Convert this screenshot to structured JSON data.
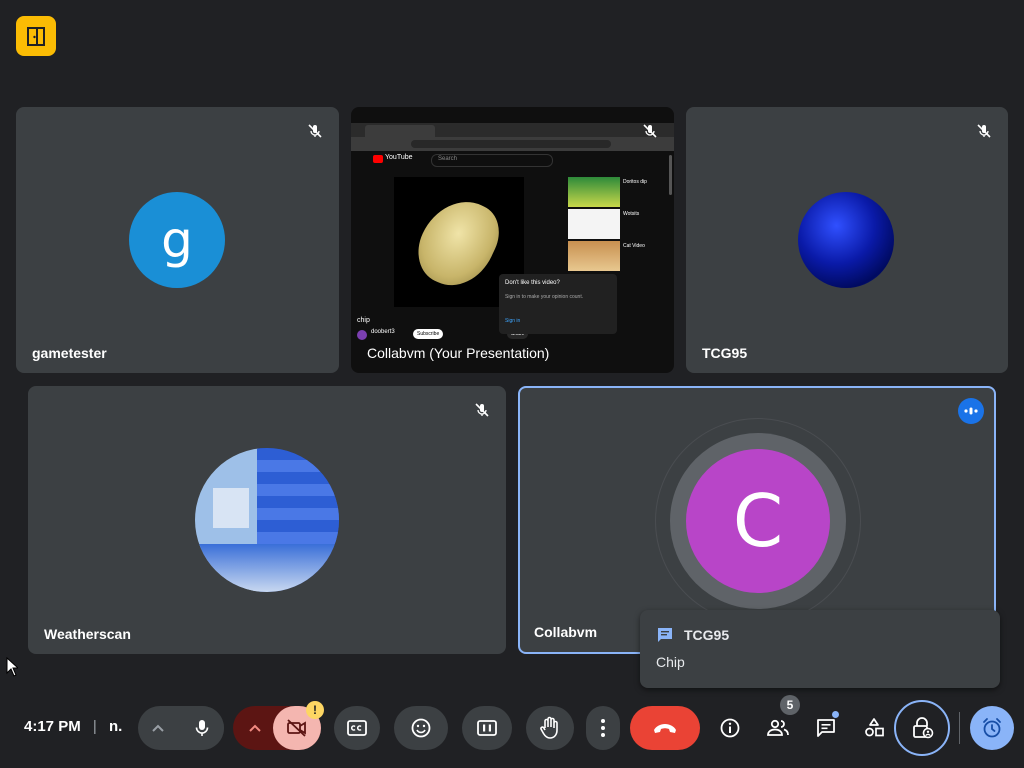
{
  "participants": {
    "tile1": {
      "name": "gametester",
      "initial": "g",
      "avatar_color": "#1a8fd6"
    },
    "tile2": {
      "name": "Collabvm (Your Presentation)"
    },
    "tile3": {
      "name": "TCG95"
    },
    "tile4": {
      "name": "Weatherscan"
    },
    "tile5": {
      "name": "Collabvm",
      "initial": "C",
      "avatar_color": "#b845c8"
    }
  },
  "presentation": {
    "site_name": "YouTube",
    "search_placeholder": "Search",
    "video_title": "chip",
    "channel": "doobert3 ",
    "subscribe_label": "Subscribe",
    "share_label": "Share",
    "dialog_title": "Don't like this video?",
    "dialog_text": "Sign in to make your opinion count.",
    "dialog_signin": "Sign in",
    "suggestions": [
      "Doritos dip",
      "Wotsits",
      "Cat Video"
    ]
  },
  "chat_popup": {
    "sender": "TCG95",
    "message": "Chip"
  },
  "toolbar": {
    "time": "4:17 PM",
    "separator": "|",
    "meeting_code": "n.",
    "people_count": "5",
    "camera_warning": "!"
  },
  "colors": {
    "accent": "#8ab4f8",
    "end_call": "#ea4335",
    "logo": "#fbbc04"
  }
}
